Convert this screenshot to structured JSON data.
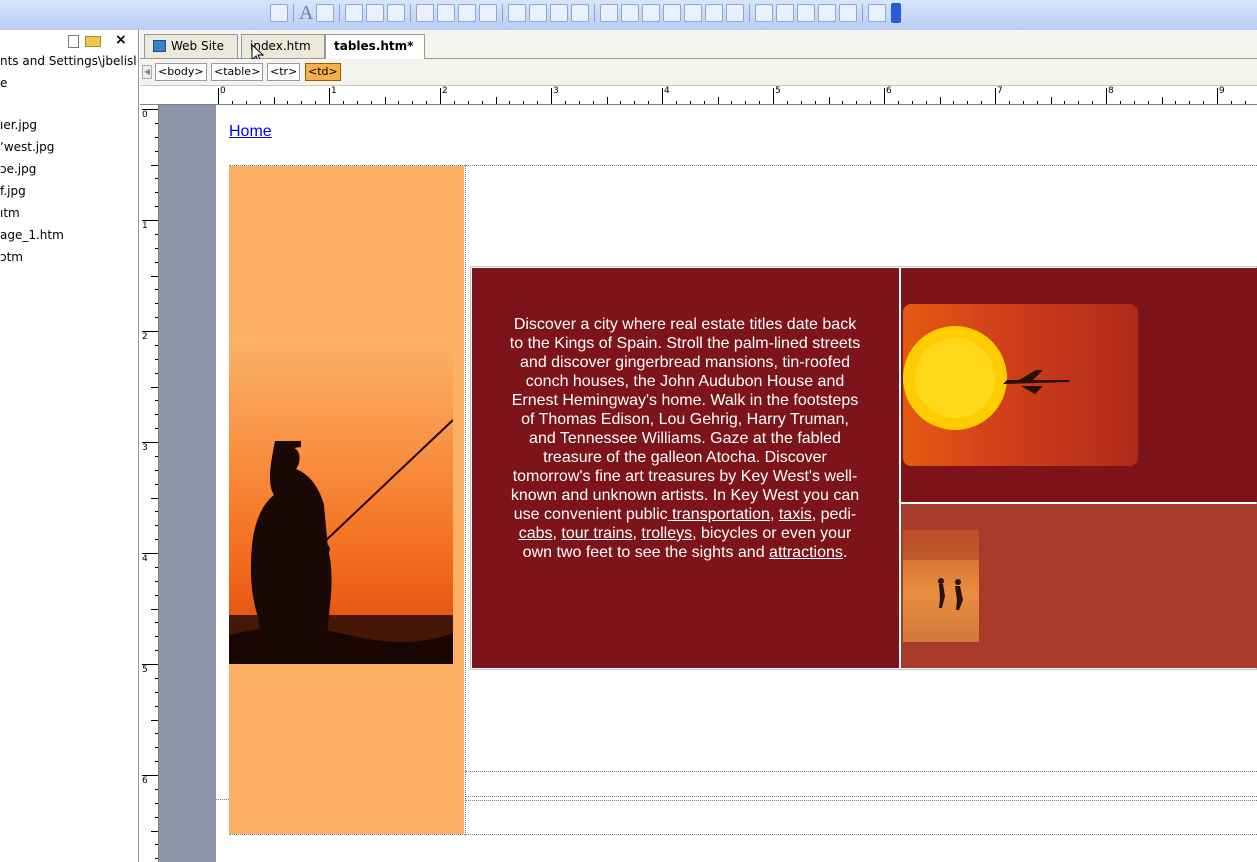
{
  "folder_panel": {
    "path": "nts and Settings\\jbelisl",
    "items": [
      "e",
      "ıer.jpg",
      "ʼwest.jpg",
      "ɔe.jpg",
      "f.jpg",
      "ıtm",
      "age_1.htm",
      "ɔtm"
    ]
  },
  "tabs": [
    {
      "label": "Web Site"
    },
    {
      "label": "index.htm"
    },
    {
      "label": "tables.htm*"
    }
  ],
  "tagbar": {
    "tags": [
      "<body>",
      "<table>",
      "<tr>",
      "<td>"
    ]
  },
  "ruler": {
    "h_numbers": [
      "0",
      "1",
      "2",
      "3",
      "4",
      "5",
      "6",
      "7",
      "8",
      "9"
    ],
    "v_numbers": [
      "0",
      "1",
      "2",
      "3",
      "4",
      "5",
      "6"
    ]
  },
  "page": {
    "home_link": "Home",
    "paragraph": {
      "intro": "Discover a city where real estate titles date back to the Kings of Spain. Stroll the palm-lined streets and discover gingerbread mansions, tin-roofed conch houses, the John Audubon House and Ernest Hemingway's home. Walk in the footsteps of Thomas Edison, Lou Gehrig, Harry Truman, and Tennessee Williams. Gaze at the fabled treasure of the galleon Atocha. Discover tomorrow's fine art treasures by Key West's well-known and unknown artists. In Key West you can use convenient public",
      "link_transportation": " transportation",
      "sep1": ", ",
      "link_taxis": "taxis",
      "sep2": ", pedi-",
      "link_cabs": "cabs",
      "sep3": ", ",
      "link_tour_trains": "tour trains",
      "sep4": ", ",
      "link_trolleys": "trolleys",
      "sep5": ", bicycles or even your own two feet to see the sights and ",
      "link_attractions": "attractions",
      "end": "."
    }
  },
  "colors": {
    "text_cell": "#7c141a",
    "photo_cell_bottom": "#a83a2a",
    "orange_column": "#fcb064",
    "active_tag": "#f6b04b",
    "link": "#0000ee"
  }
}
